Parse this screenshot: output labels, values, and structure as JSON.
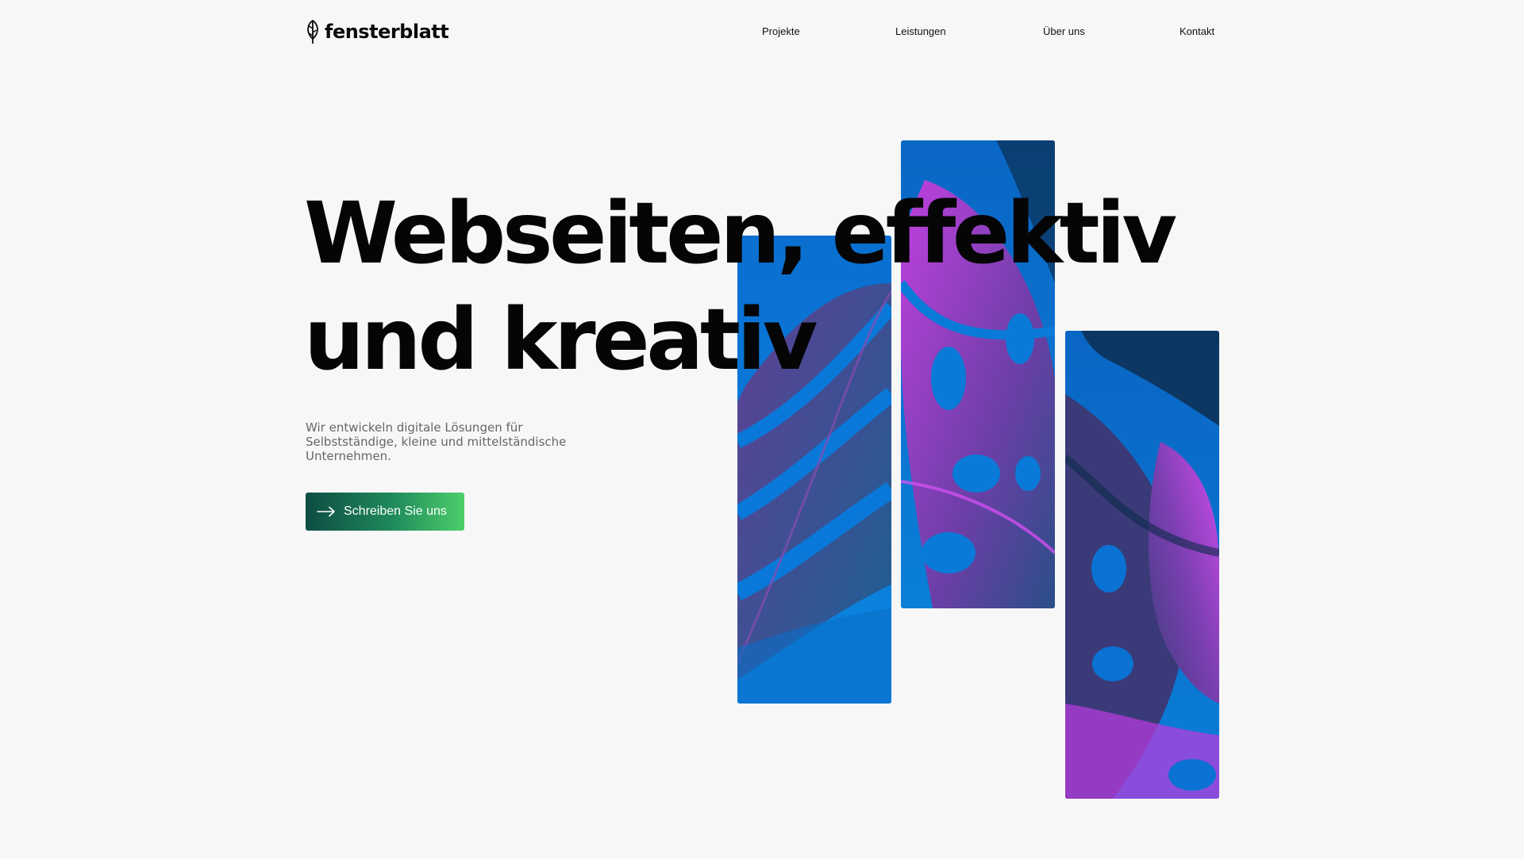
{
  "header": {
    "logo_text": "fensterblatt",
    "nav": [
      {
        "label": "Projekte"
      },
      {
        "label": "Leistungen"
      },
      {
        "label": "Über uns"
      },
      {
        "label": "Kontakt"
      }
    ]
  },
  "hero": {
    "headline_line1": "Webseiten, effektiv",
    "headline_line2": "und kreativ",
    "subtitle": "Wir entwickeln digitale Lösungen für Selbstständige, kleine und mittelständische Unternehmen.",
    "cta_label": "Schreiben Sie uns",
    "cta_icon": "arrow-right-icon"
  },
  "images": [
    {
      "name": "monstera-leaf-image-left"
    },
    {
      "name": "monstera-leaf-image-middle"
    },
    {
      "name": "monstera-leaf-image-right"
    }
  ],
  "colors": {
    "background": "#f7f7f7",
    "text": "#050505",
    "cta_gradient_start": "#0e4d43",
    "cta_gradient_end": "#4ccf6a",
    "image_blue": "#0a78d8",
    "leaf_purple": "#b43cdc"
  }
}
